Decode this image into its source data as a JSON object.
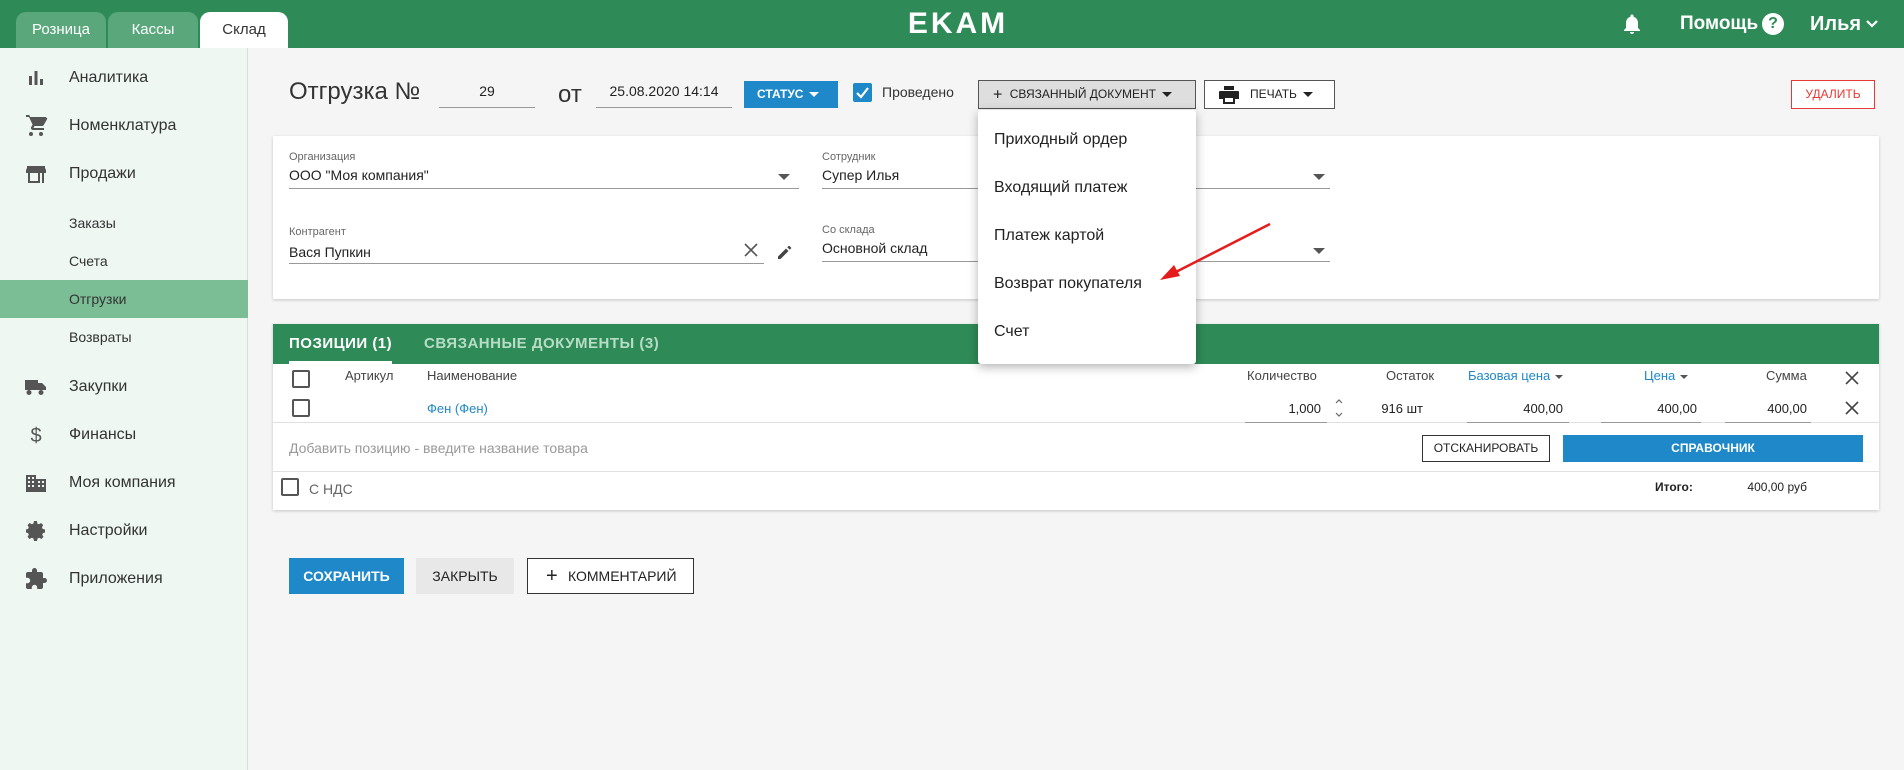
{
  "colors": {
    "brand": "#2e8b57",
    "accent": "#1e88c8",
    "danger": "#e53935"
  },
  "topbar": {
    "tabs": [
      {
        "label": "Розница",
        "active": false
      },
      {
        "label": "Кассы",
        "active": false
      },
      {
        "label": "Склад",
        "active": true
      }
    ],
    "logo": "EKAM",
    "help": "Помощь",
    "help_icon": "?",
    "user": "Илья"
  },
  "sidebar": {
    "items": [
      {
        "label": "Аналитика",
        "icon": "bar-chart-icon"
      },
      {
        "label": "Номенклатура",
        "icon": "cart-icon"
      },
      {
        "label": "Продажи",
        "icon": "store-icon"
      },
      {
        "label": "Закупки",
        "icon": "truck-icon"
      },
      {
        "label": "Финансы",
        "icon": "dollar-icon"
      },
      {
        "label": "Моя компания",
        "icon": "building-icon"
      },
      {
        "label": "Настройки",
        "icon": "gear-icon"
      },
      {
        "label": "Приложения",
        "icon": "puzzle-icon"
      }
    ],
    "sales_sub": [
      {
        "label": "Заказы",
        "active": false
      },
      {
        "label": "Счета",
        "active": false
      },
      {
        "label": "Отгрузки",
        "active": true
      },
      {
        "label": "Возвраты",
        "active": false
      }
    ]
  },
  "header": {
    "title": "Отгрузка №",
    "number": "29",
    "date_prefix": "от",
    "date": "25.08.2020 14:14",
    "status_label": "СТАТУС",
    "posted_label": "Проведено",
    "posted_checked": true,
    "linked_doc_label": "СВЯЗАННЫЙ ДОКУМЕНТ",
    "print_label": "ПЕЧАТЬ",
    "delete_label": "УДАЛИТЬ"
  },
  "form": {
    "organization_label": "Организация",
    "organization_value": "ООО \"Моя компания\"",
    "employee_label": "Сотрудник",
    "employee_value": "Супер Илья",
    "counterparty_label": "Контрагент",
    "counterparty_value": "Вася Пупкин",
    "warehouse_label": "Со склада",
    "warehouse_value": "Основной склад"
  },
  "positions": {
    "tab_positions": "ПОЗИЦИИ (1)",
    "tab_linked": "СВЯЗАННЫЕ ДОКУМЕНТЫ (3)",
    "columns": {
      "article": "Артикул",
      "name": "Наименование",
      "quantity": "Количество",
      "stock": "Остаток",
      "base_price": "Базовая цена",
      "price": "Цена",
      "sum": "Сумма"
    },
    "rows": [
      {
        "article": "",
        "name": "Фен (Фен)",
        "quantity": "1,000",
        "stock": "916 шт",
        "base_price": "400,00",
        "price": "400,00",
        "sum": "400,00"
      }
    ],
    "add_placeholder": "Добавить позицию - введите название товара",
    "scan_label": "ОТСКАНИРОВАТЬ",
    "reference_label": "СПРАВОЧНИК",
    "vat_label": "С НДС",
    "total_label": "Итого:",
    "total_value": "400,00 руб"
  },
  "footer": {
    "save_label": "СОХРАНИТЬ",
    "close_label": "ЗАКРЫТЬ",
    "comment_label": "КОММЕНТАРИЙ"
  },
  "linked_menu": {
    "items": [
      "Приходный ордер",
      "Входящий платеж",
      "Платеж картой",
      "Возврат покупателя",
      "Счет"
    ]
  }
}
